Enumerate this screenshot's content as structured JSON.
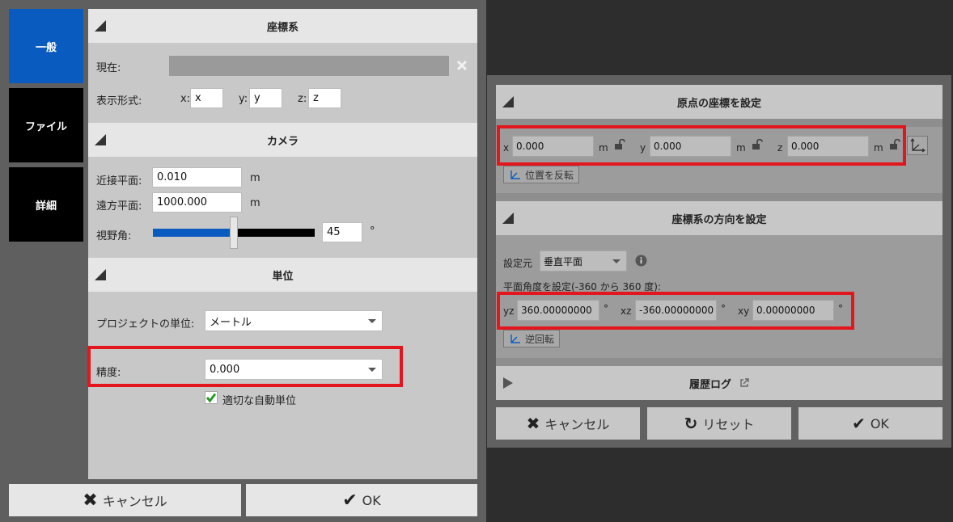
{
  "left_dialog": {
    "sidebar": {
      "items": [
        {
          "label": "一般"
        },
        {
          "label": "ファイル"
        },
        {
          "label": "詳細"
        }
      ]
    },
    "coordinate_system": {
      "title": "座標系",
      "current_label": "現在:",
      "display_format_label": "表示形式:",
      "x_label": "x:",
      "x_value": "x",
      "y_label": "y:",
      "y_value": "y",
      "z_label": "z:",
      "z_value": "z"
    },
    "camera": {
      "title": "カメラ",
      "near_label": "近接平面:",
      "near_value": "0.010",
      "near_unit": "m",
      "far_label": "遠方平面:",
      "far_value": "1000.000",
      "far_unit": "m",
      "fov_label": "視野角:",
      "fov_value": "45",
      "fov_unit": "°",
      "fov_slider_fraction": 0.5
    },
    "units": {
      "title": "単位",
      "project_unit_label": "プロジェクトの単位:",
      "project_unit_value": "メートル",
      "precision_label": "精度:",
      "precision_value": "0.000",
      "auto_unit_label": "適切な自動単位",
      "auto_unit_checked": true
    },
    "buttons": {
      "cancel": "キャンセル",
      "ok": "OK"
    }
  },
  "right_dialog": {
    "origin": {
      "title": "原点の座標を設定",
      "x_label": "x",
      "x_value": "0.000",
      "y_label": "y",
      "y_value": "0.000",
      "z_label": "z",
      "z_value": "0.000",
      "unit": "m",
      "flip_label": "位置を反転"
    },
    "orientation": {
      "title": "座標系の方向を設定",
      "source_label": "設定元",
      "source_value": "垂直平面",
      "angle_label": "平面角度を設定(-360 から 360 度):",
      "yz_label": "yz",
      "yz_value": "360.00000000",
      "xz_label": "xz",
      "xz_value": "-360.00000000",
      "xy_label": "xy",
      "xy_value": "0.00000000",
      "deg": "°",
      "reverse_label": "逆回転"
    },
    "history": {
      "title": "履歴ログ"
    },
    "buttons": {
      "cancel": "キャンセル",
      "reset": "リセット",
      "ok": "OK"
    }
  },
  "colors": {
    "active_tab": "#0a5bc0",
    "highlight_box": "#e3161d",
    "slider_fill": "#0a5bc0"
  }
}
